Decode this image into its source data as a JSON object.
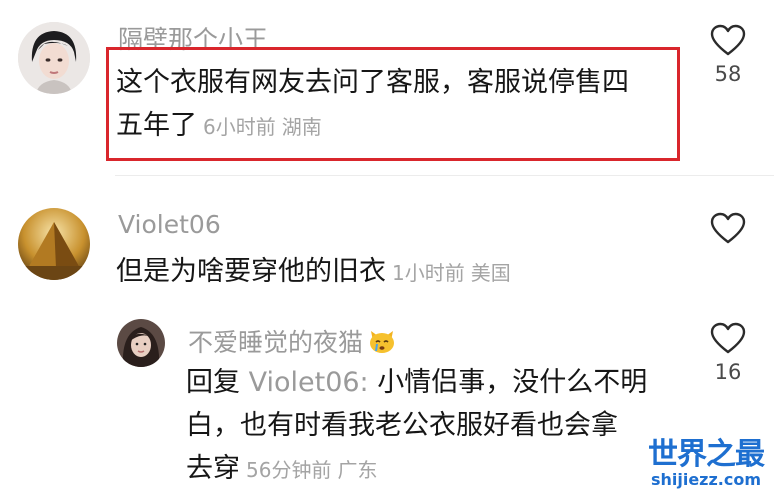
{
  "comments": [
    {
      "username": "隔壁那个小王",
      "text_line1": "这个衣服有网友去问了客服，客服说停售四",
      "text_line2": "五年了",
      "time": "6小时前",
      "location": "湖南",
      "likes": "58",
      "avatar_icon": "woman-portrait-avatar",
      "highlighted": true,
      "highlight_color": "#d9262c"
    },
    {
      "username": "Violet06",
      "text": "但是为啥要穿他的旧衣",
      "time": "1小时前",
      "location": "美国",
      "likes": "",
      "avatar_icon": "golden-pyramid-avatar"
    }
  ],
  "reply": {
    "username": "不爱睡觉的夜猫",
    "username_emoji": "crying-cat-emoji",
    "prefix": "回复",
    "reply_to": "Violet06:",
    "text_line1": "小情侣事，没什么不明",
    "text_line2": "白，也有时看我老公衣服好看也会拿",
    "text_line3": "去穿",
    "time": "56分钟前",
    "location": "广东",
    "likes": "16",
    "avatar_icon": "girl-portrait-avatar"
  },
  "watermark": {
    "title": "世界之最",
    "url": "shijiezz.com",
    "color": "#1e6fd0"
  },
  "colors": {
    "text": "#161616",
    "secondary": "#9a9a9a",
    "meta": "#a4a4a4",
    "highlight": "#d9262c"
  }
}
